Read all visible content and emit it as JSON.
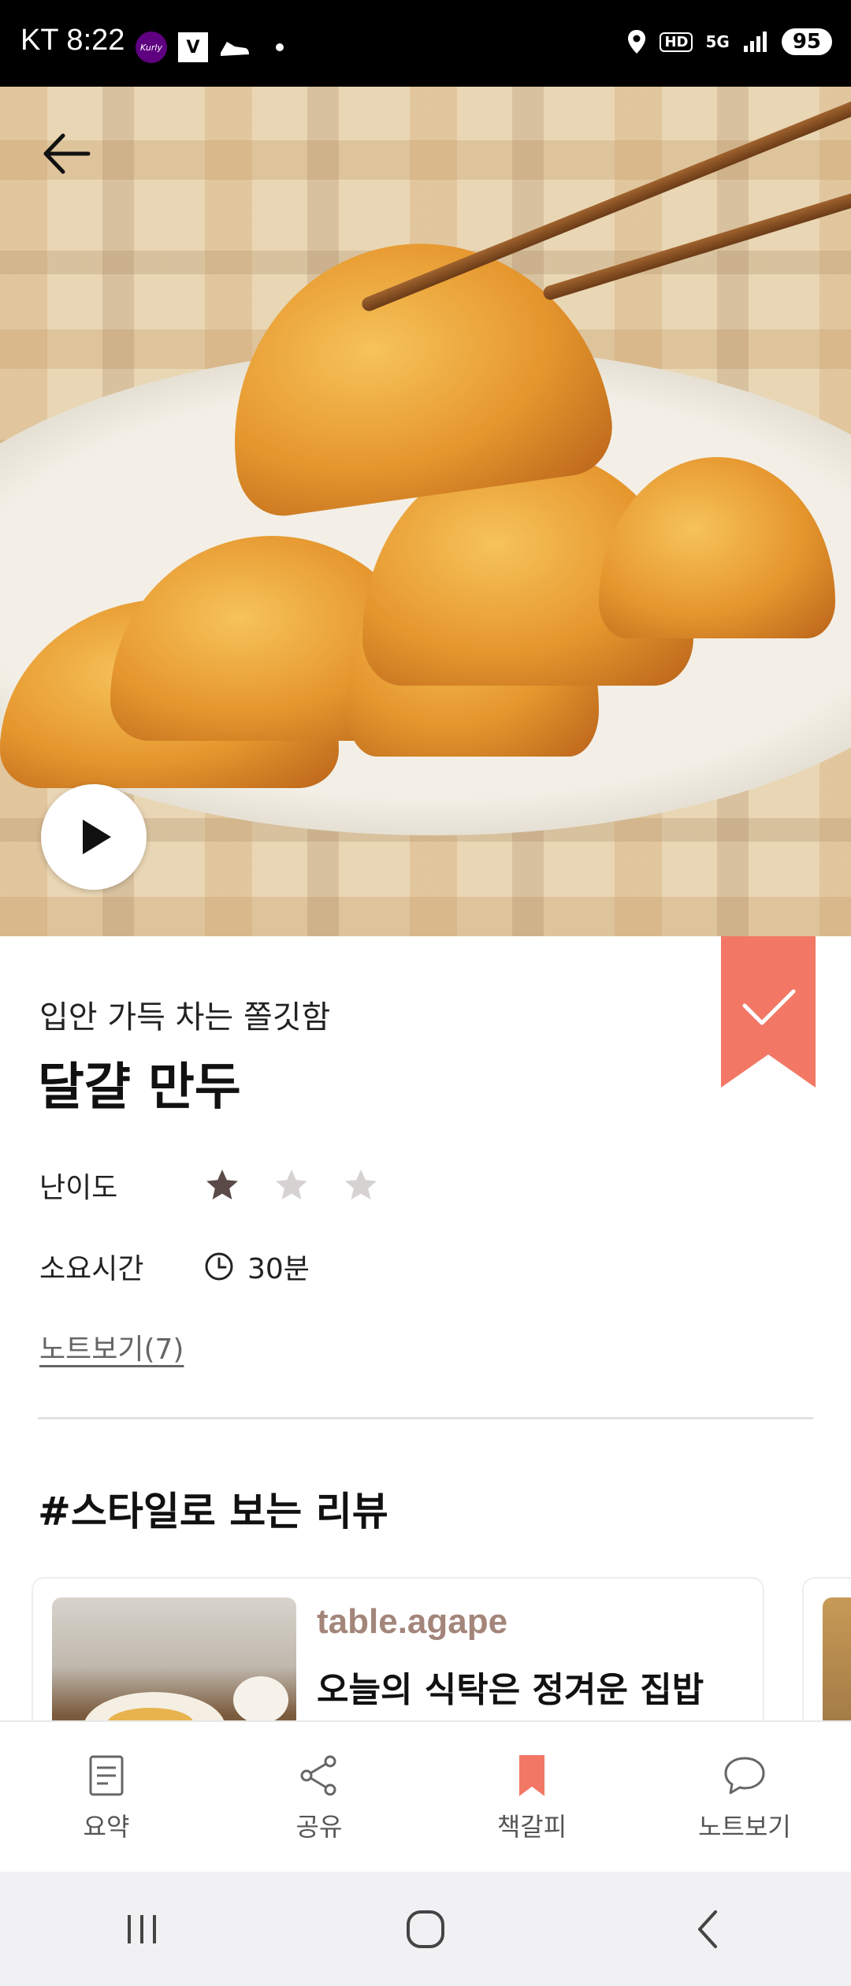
{
  "status_bar": {
    "carrier_time": "KT 8:22",
    "kurly_badge": "Kurly",
    "v_badge": "V",
    "hd": "HD",
    "net": "5G",
    "battery": "95"
  },
  "recipe": {
    "subtitle": "입안 가득 차는 쫄깃함",
    "title": "달걀 만두",
    "difficulty_label": "난이도",
    "difficulty_rating": 1,
    "difficulty_max": 3,
    "time_label": "소요시간",
    "time_value": "30분",
    "notes_link": "노트보기(7)"
  },
  "reviews": {
    "section_title": "#스타일로 보는 리뷰",
    "cards": [
      {
        "author": "table.agape",
        "text": "오늘의 식탁은 정겨운 집밥"
      }
    ]
  },
  "bottom_nav": [
    {
      "label": "요약",
      "icon": "document-icon",
      "active": false
    },
    {
      "label": "공유",
      "icon": "share-icon",
      "active": false
    },
    {
      "label": "책갈피",
      "icon": "bookmark-icon",
      "active": true
    },
    {
      "label": "노트보기",
      "icon": "speech-bubble-icon",
      "active": false
    }
  ],
  "colors": {
    "accent": "#f27865",
    "star_filled": "#5a4a48",
    "star_empty": "#d6d2d2",
    "author": "#a3857a"
  }
}
